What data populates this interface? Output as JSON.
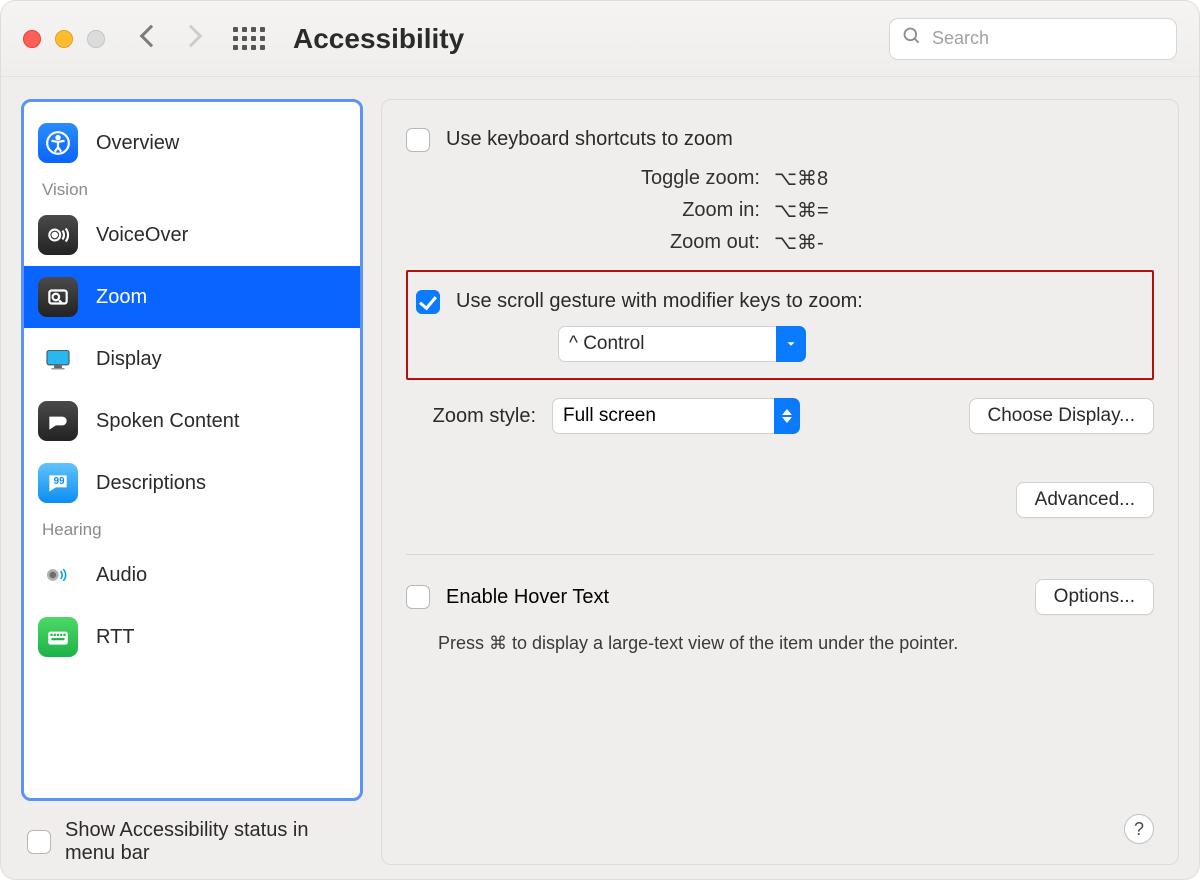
{
  "header": {
    "title": "Accessibility",
    "search_placeholder": "Search"
  },
  "sidebar": {
    "groups": [
      {
        "label": "",
        "items": [
          {
            "name": "overview",
            "label": "Overview"
          }
        ]
      },
      {
        "label": "Vision",
        "items": [
          {
            "name": "voiceover",
            "label": "VoiceOver"
          },
          {
            "name": "zoom",
            "label": "Zoom",
            "selected": true
          },
          {
            "name": "display",
            "label": "Display"
          },
          {
            "name": "spoken-content",
            "label": "Spoken Content"
          },
          {
            "name": "descriptions",
            "label": "Descriptions"
          }
        ]
      },
      {
        "label": "Hearing",
        "items": [
          {
            "name": "audio",
            "label": "Audio"
          },
          {
            "name": "rtt",
            "label": "RTT"
          }
        ]
      }
    ]
  },
  "main": {
    "kb_shortcuts_label": "Use keyboard shortcuts to zoom",
    "shortcuts": {
      "toggle_label": "Toggle zoom:",
      "toggle_keys": "⌥⌘8",
      "in_label": "Zoom in:",
      "in_keys": "⌥⌘=",
      "out_label": "Zoom out:",
      "out_keys": "⌥⌘-"
    },
    "scroll_label": "Use scroll gesture with modifier keys to zoom:",
    "modifier_value": "^ Control",
    "zoom_style_label": "Zoom style:",
    "zoom_style_value": "Full screen",
    "choose_display_btn": "Choose Display...",
    "advanced_btn": "Advanced...",
    "hover_label": "Enable Hover Text",
    "options_btn": "Options...",
    "hover_desc": "Press ⌘ to display a large-text view of the item under the pointer."
  },
  "footer": {
    "status_label": "Show Accessibility status in menu bar",
    "help_label": "?"
  }
}
